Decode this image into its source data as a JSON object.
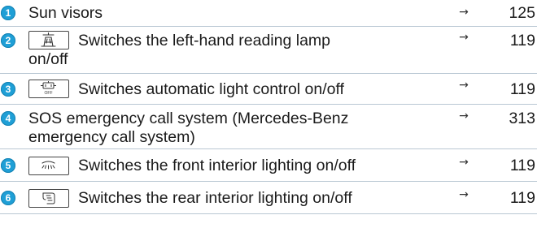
{
  "colors": {
    "badge": "#1f9fd6",
    "divider": "#b9c7d3",
    "text": "#1a1a1a"
  },
  "items": [
    {
      "number": "1",
      "icon": null,
      "text": "Sun visors",
      "text2": "",
      "arrow": "→",
      "page": "125"
    },
    {
      "number": "2",
      "icon": "reading-lamp-icon",
      "text": "Switches the left-hand reading lamp",
      "text2": "on/off",
      "arrow": "→",
      "page": "119"
    },
    {
      "number": "3",
      "icon": "automatic-light-control-icon",
      "icon_label": "OFF",
      "text": "Switches automatic light control on/off",
      "text2": "",
      "arrow": "→",
      "page": "119"
    },
    {
      "number": "4",
      "icon": null,
      "text": "SOS emergency call system (Mercedes-Benz",
      "text2": "emergency call system)",
      "arrow": "→",
      "page": "313"
    },
    {
      "number": "5",
      "icon": "front-interior-light-icon",
      "text": "Switches the front interior lighting on/off",
      "text2": "",
      "arrow": "→",
      "page": "119"
    },
    {
      "number": "6",
      "icon": "rear-interior-light-icon",
      "text": "Switches the rear interior lighting on/off",
      "text2": "",
      "arrow": "→",
      "page": "119"
    }
  ]
}
